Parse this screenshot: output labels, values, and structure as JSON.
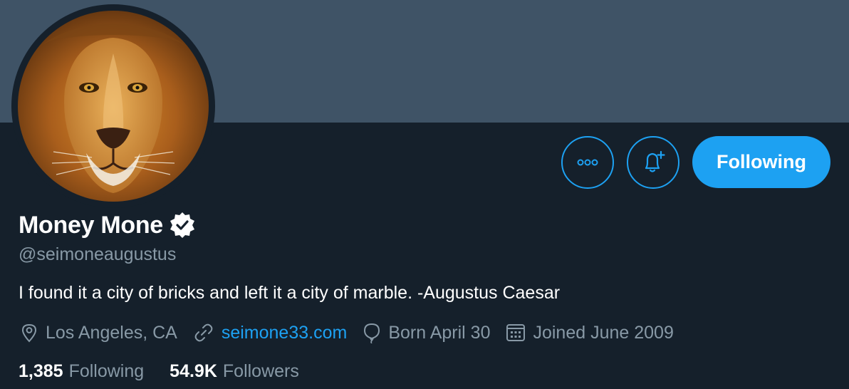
{
  "profile": {
    "display_name": "Money Mone",
    "handle": "@seimoneaugustus",
    "bio": "I found it a city of bricks and left it a city of marble. -Augustus Caesar",
    "verified": true,
    "avatar_icon": "lion-avatar"
  },
  "meta": {
    "location": "Los Angeles, CA",
    "website": "seimone33.com",
    "birthday": "Born April 30",
    "joined": "Joined June 2009"
  },
  "stats": {
    "following_count": "1,385",
    "following_label": "Following",
    "followers_count": "54.9K",
    "followers_label": "Followers"
  },
  "actions": {
    "follow_button_label": "Following",
    "more_icon": "more-icon",
    "notify_icon": "bell-plus-icon"
  },
  "colors": {
    "background": "#15202b",
    "banner": "#3f5366",
    "accent": "#1da1f2",
    "secondary_text": "#8899a6"
  }
}
